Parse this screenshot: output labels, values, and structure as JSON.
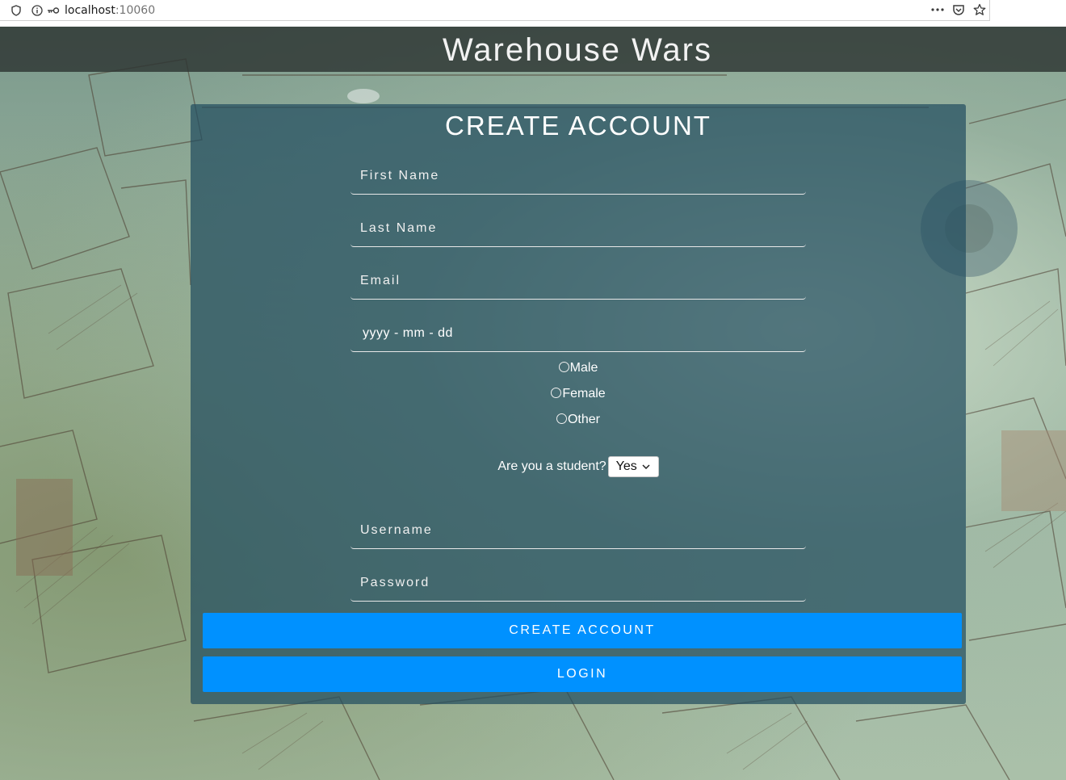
{
  "browser": {
    "url_host": "localhost",
    "url_port": ":10060"
  },
  "header": {
    "title": "Warehouse Wars"
  },
  "form": {
    "title": "CREATE ACCOUNT",
    "fields": {
      "first_name": "First Name",
      "last_name": "Last Name",
      "email": "Email",
      "dob": "yyyy - mm - dd",
      "username": "Username",
      "password": "Password"
    },
    "gender_options": [
      "Male",
      "Female",
      "Other"
    ],
    "student_label": "Are you a student?",
    "student_value": "Yes",
    "create_button": "CREATE ACCOUNT",
    "login_button": "LOGIN"
  },
  "colors": {
    "accent": "#0091ff",
    "panel": "#224e5f",
    "header": "#2d3432"
  }
}
